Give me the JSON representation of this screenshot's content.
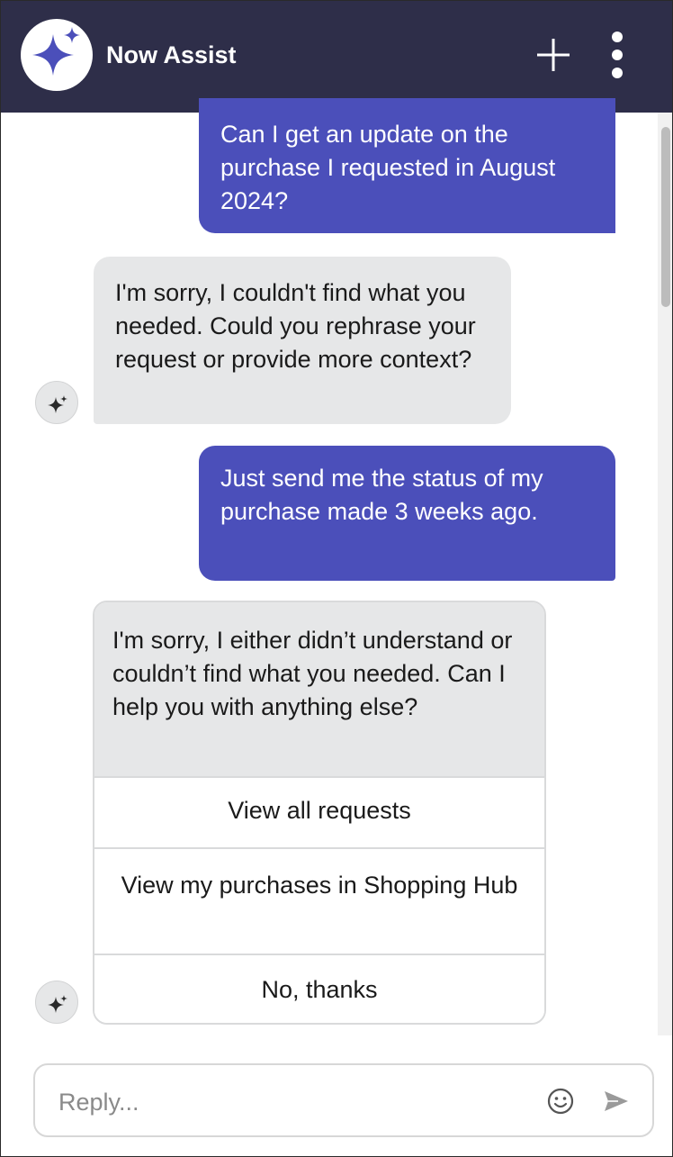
{
  "header": {
    "title": "Now Assist",
    "logo_icon": "sparkle-icon",
    "new_chat_icon": "plus-icon",
    "more_icon": "more-vertical-icon",
    "background": "#2e2e49"
  },
  "conversation": {
    "messages": [
      {
        "sender": "user",
        "text": "Can I get an update on the purchase I requested in August 2024?"
      },
      {
        "sender": "assistant",
        "text": "I'm sorry, I couldn't find what you needed. Could you rephrase your request or provide more context?"
      },
      {
        "sender": "user",
        "text": "Just send me the status of my purchase made 3 weeks ago."
      },
      {
        "sender": "assistant",
        "text": "I'm sorry, I either didn’t understand or couldn’t find what you needed. Can I help you with anything else?",
        "options": [
          "View all requests",
          "View my purchases in Shopping Hub",
          "No, thanks"
        ]
      }
    ],
    "user_bubble_color": "#4b4fba",
    "assistant_bubble_color": "#e6e7e8"
  },
  "composer": {
    "placeholder": "Reply...",
    "emoji_icon": "smiley-icon",
    "send_icon": "send-icon"
  }
}
